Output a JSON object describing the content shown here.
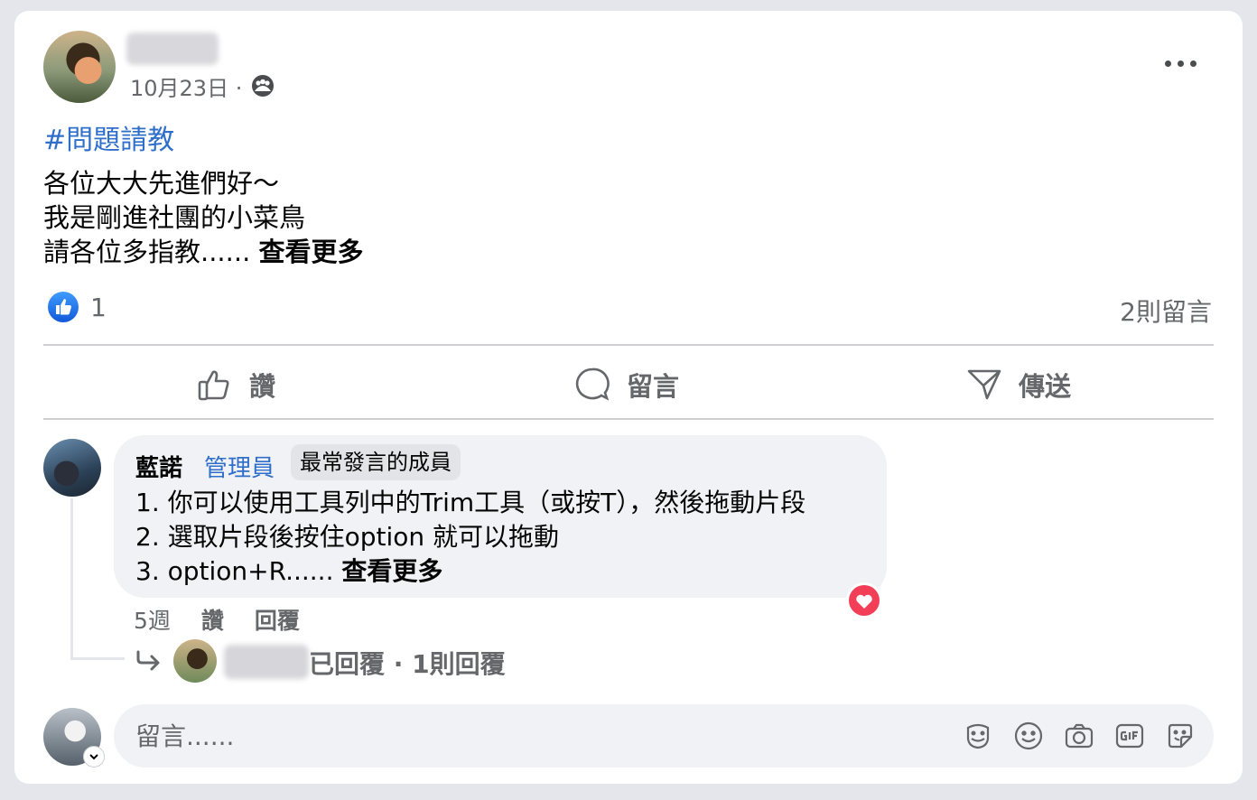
{
  "post": {
    "date": "10月23日 · ",
    "hashtag": "#問題請教",
    "lines": [
      "各位大大先進們好～",
      "我是剛進社團的小菜鳥",
      "請各位多指教......"
    ],
    "see_more": "查看更多",
    "like_count": "1",
    "comment_count": "2則留言"
  },
  "actions": {
    "like": "讚",
    "comment": "留言",
    "share": "傳送"
  },
  "comment": {
    "author": "藍諾",
    "role": "管理員",
    "badge": "最常發言的成員",
    "lines": [
      "1. 你可以使用工具列中的Trim工具（或按T），然後拖動片段",
      "2. 選取片段後按住option 就可以拖動",
      "3. option+R......"
    ],
    "see_more": "查看更多",
    "time": "5週",
    "like": "讚",
    "reply": "回覆",
    "reply_summary": "已回覆 · 1則回覆"
  },
  "composer": {
    "placeholder": "留言......"
  },
  "colors": {
    "link_blue": "#2f6fca",
    "muted_text": "#65676b",
    "like_blue": "#1877f2",
    "heart_red": "#f33e58"
  }
}
